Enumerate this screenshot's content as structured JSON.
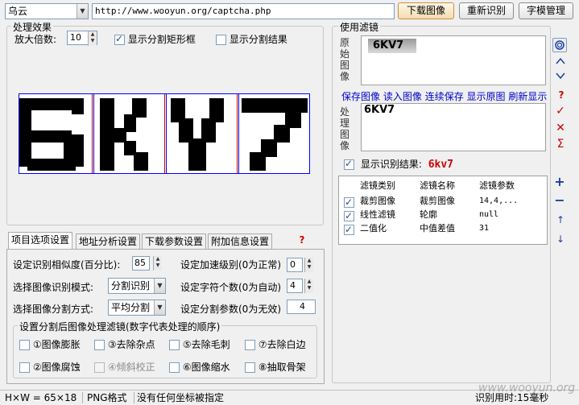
{
  "toolbar": {
    "site_select": "乌云",
    "url": "http://www.wooyun.org/captcha.php",
    "download_btn": "下载图像",
    "reidentify_btn": "重新识别",
    "fontlib_btn": "字模管理"
  },
  "processing": {
    "title": "处理效果",
    "zoom_label": "放大倍数:",
    "zoom_value": "10",
    "show_boxes_label": "显示分割矩形框",
    "show_boxes_checked": true,
    "show_result_label": "显示分割结果",
    "show_result_checked": false,
    "captcha_text": "6KV7"
  },
  "filters": {
    "title": "使用滤镜",
    "original_label": "原始图像",
    "original_text": "6KV7",
    "actions": [
      "保存图像",
      "读入图像",
      "连续保存",
      "显示原图",
      "刷新显示"
    ],
    "processed_label": "处理图像",
    "processed_text": "6KV7",
    "show_result_label": "显示识别结果:",
    "show_result_checked": true,
    "result_value": "6kv7",
    "table_headers": [
      "滤镜类别",
      "滤镜名称",
      "滤镜参数"
    ],
    "table_rows": [
      {
        "checked": true,
        "category": "裁剪图像",
        "name": "裁剪图像",
        "params": "14,4,..."
      },
      {
        "checked": true,
        "category": "线性滤镜",
        "name": "轮廓",
        "params": "null"
      },
      {
        "checked": true,
        "category": "二值化",
        "name": "中值差值",
        "params": "31"
      }
    ]
  },
  "tabs": [
    "项目选项设置",
    "地址分析设置",
    "下载参数设置",
    "附加信息设置"
  ],
  "settings": {
    "similarity_label": "设定识别相似度(百分比):",
    "similarity_value": "85",
    "accel_label": "设定加速级别(0为正常)",
    "accel_value": "0",
    "mode_label": "选择图像识别模式:",
    "mode_value": "分割识别",
    "charcount_label": "设定字符个数(0为自动)",
    "charcount_value": "4",
    "split_label": "选择图像分割方式:",
    "split_value": "平均分割",
    "splitparam_label": "设定分割参数(0为无效)",
    "splitparam_value": "4",
    "post_title": "设置分割后图像处理滤镜(数字代表处理的顺序)",
    "post_options": [
      "①图像膨胀",
      "③去除杂点",
      "⑤去除毛刺",
      "⑦去除白边",
      "②图像腐蚀",
      "④倾斜校正",
      "⑥图像缩水",
      "⑧抽取骨架"
    ]
  },
  "statusbar": {
    "size": "H×W = 65×18",
    "format": "PNG格式",
    "message": "没有任何坐标被指定",
    "timing": "识别用时:15毫秒",
    "watermark": "www.wooyun.org"
  },
  "colors": {
    "accent_red": "#d00000",
    "result_red": "#cc0000",
    "divider_blue": "#0000ff",
    "link_blue": "#0000cc"
  }
}
